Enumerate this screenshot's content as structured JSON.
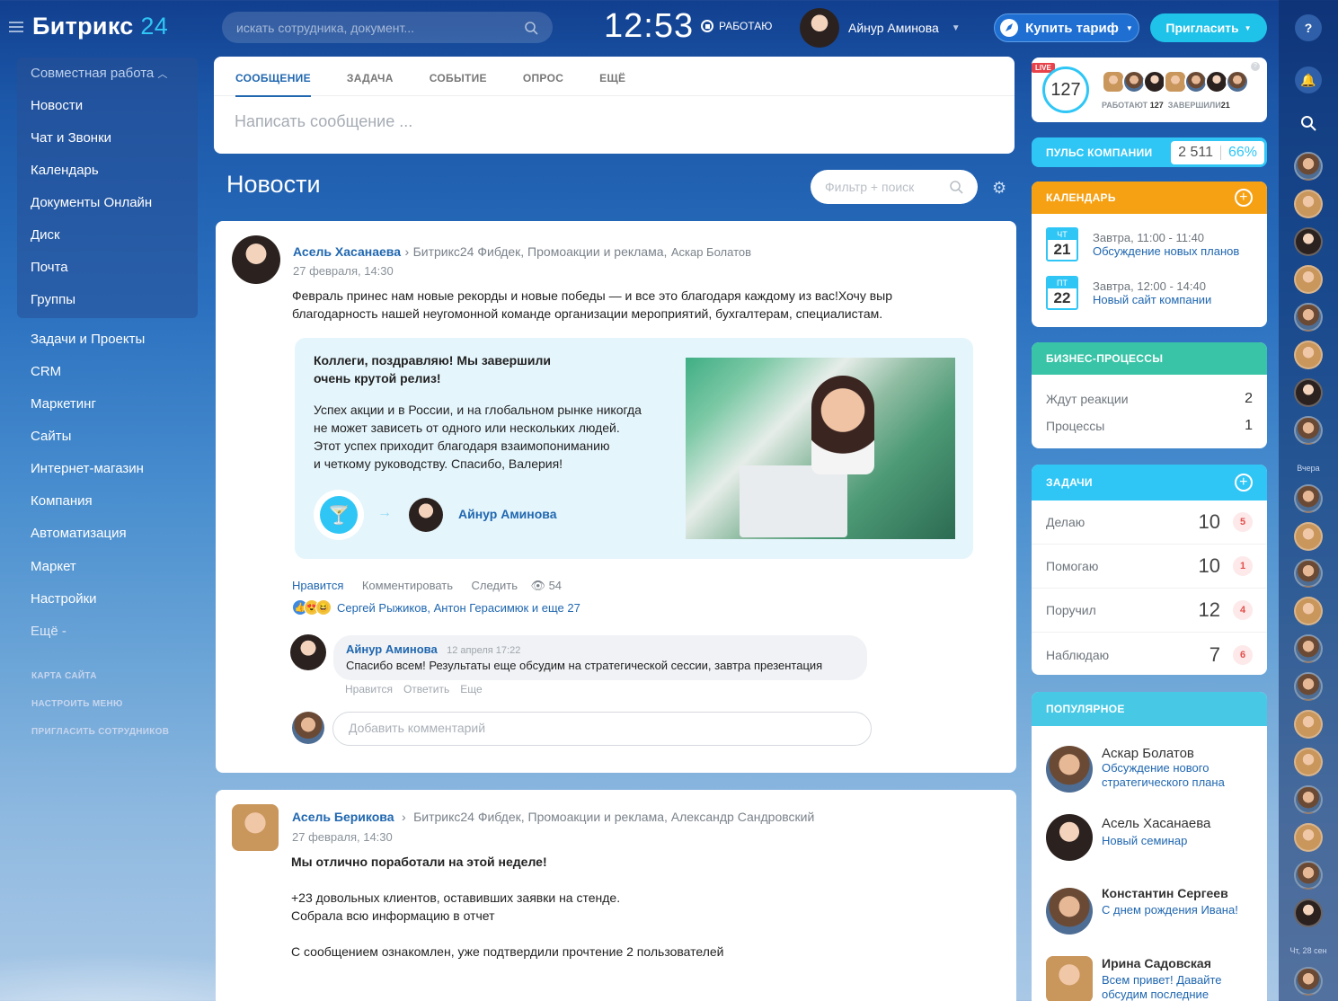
{
  "header": {
    "logo_main": "Битрикс",
    "logo_num": "24",
    "search_placeholder": "искать сотрудника, документ...",
    "clock": "12:53",
    "work_status": "РАБОТАЮ",
    "user_name": "Айнур Аминова",
    "buy_label": "Купить тариф",
    "invite_label": "Пригласить"
  },
  "sidebar": {
    "group_title": "Совместная работа",
    "group_items": [
      "Новости",
      "Чат и Звонки",
      "Календарь",
      "Документы Онлайн",
      "Диск",
      "Почта",
      "Группы"
    ],
    "items": [
      "Задачи и Проекты",
      "CRM",
      "Маркетинг",
      "Сайты",
      "Интернет-магазин",
      "Компания",
      "Автоматизация",
      "Маркет",
      "Настройки",
      "Ещё -"
    ],
    "links": [
      "КАРТА САЙТА",
      "НАСТРОИТЬ МЕНЮ",
      "ПРИГЛАСИТЬ СОТРУДНИКОВ"
    ]
  },
  "composer": {
    "tabs": [
      "СООБЩЕНИЕ",
      "ЗАДАЧА",
      "СОБЫТИЕ",
      "ОПРОС",
      "ЕЩЁ"
    ],
    "placeholder": "Написать сообщение ..."
  },
  "feed": {
    "title": "Новости",
    "filter_placeholder": "Фильтр + поиск"
  },
  "post1": {
    "author": "Асель Хасанаева",
    "recipients": "Битрикс24 Фибдек, Промоакции и реклама,",
    "recipient_extra": "Аскар Болатов",
    "date": "27 февраля, 14:30",
    "text_line1": "Февраль принес нам новые рекорды и новые победы — и все это благодаря каждому из вас!Хочу выр",
    "text_line2": "благодарность нашей неугомонной команде организации мероприятий, бухгалтерам, специалистам.",
    "card_title_line1": "Коллеги, поздравляю! Мы завершили",
    "card_title_line2": "очень крутой релиз!",
    "card_body": [
      "Успех акции и в России, и на глобальном рынке никогда",
      "не может зависеть от одного или нескольких людей.",
      "Этот успех приходит благодаря взаимопониманию",
      "и четкому руководству. Спасибо, Валерия!"
    ],
    "card_recipient": "Айнур Аминова",
    "actions": {
      "like": "Нравится",
      "comment": "Комментировать",
      "follow": "Следить",
      "views": "54"
    },
    "likers": "Сергей Рыжиков, Антон Герасимюк и еще 27",
    "comment": {
      "author": "Айнур Аминова",
      "date": "12 апреля 17:22",
      "text": "Спасибо всем! Результаты еще обсудим на стратегической сессии, завтра презентация",
      "actions": [
        "Нравится",
        "Ответить",
        "Еще"
      ]
    },
    "comment_placeholder": "Добавить комментарий"
  },
  "post2": {
    "author": "Асель Берикова",
    "recipients": "Битрикс24 Фибдек, Промоакции и реклама, Александр Сандровский",
    "date": "27 февраля, 14:30",
    "headline": "Мы отлично поработали на этой неделе!",
    "line1": "+23 довольных клиентов, оставивших заявки на стенде.",
    "line2": "Собрала всю информацию в отчет",
    "line3": "С сообщением ознакомлен, уже подтвердили прочтение 2 пользователей"
  },
  "presence": {
    "live": "LIVE",
    "count": "127",
    "working_label": "РАБОТАЮТ",
    "working_count": "127",
    "done_label": "ЗАВЕРШИЛИ",
    "done_count": "21"
  },
  "pulse": {
    "label": "ПУЛЬС КОМПАНИИ",
    "value": "2 511",
    "percent": "66%"
  },
  "calendar": {
    "title": "КАЛЕНДАРЬ",
    "events": [
      {
        "dow": "ЧТ",
        "day": "21",
        "when": "Завтра, 11:00 - 11:40",
        "title": "Обсуждение новых планов"
      },
      {
        "dow": "ПТ",
        "day": "22",
        "when": "Завтра, 12:00 - 14:40",
        "title": "Новый сайт компании"
      }
    ]
  },
  "bp": {
    "title": "БИЗНЕС-ПРОЦЕССЫ",
    "rows": [
      {
        "label": "Ждут реакции",
        "value": "2"
      },
      {
        "label": "Процессы",
        "value": "1"
      }
    ]
  },
  "tasks": {
    "title": "ЗАДАЧИ",
    "rows": [
      {
        "label": "Делаю",
        "value": "10",
        "count": "5"
      },
      {
        "label": "Помогаю",
        "value": "10",
        "count": "1"
      },
      {
        "label": "Поручил",
        "value": "12",
        "count": "4"
      },
      {
        "label": "Наблюдаю",
        "value": "7",
        "count": "6"
      }
    ]
  },
  "popular": {
    "title": "ПОПУЛЯРНОЕ",
    "items": [
      {
        "name": "Аскар Болатов",
        "text1": "Обсуждение нового",
        "text2": "стратегического плана"
      },
      {
        "name": "Асель Хасанаева",
        "text1": "Новый семинар",
        "text2": ""
      },
      {
        "name": "Константин Сергеев",
        "text1": "С днем рождения Ивана!",
        "text2": ""
      },
      {
        "name": "Ирина Садовская",
        "text1": "Всем привет! Давайте",
        "text2": "обсудим последние"
      }
    ]
  },
  "rail": {
    "yesterday": "Вчера",
    "date_label": "Чт, 28 сен"
  },
  "colors": {
    "accent": "#2fc6f6",
    "link": "#2067b0",
    "calendar": "#f6a113",
    "bp": "#3ac4a7",
    "tasks": "#2fc6f6",
    "popular": "#47c9e6"
  }
}
